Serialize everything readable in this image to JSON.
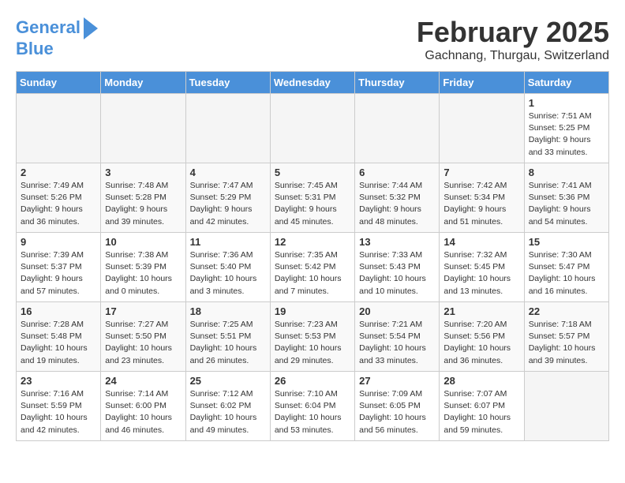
{
  "header": {
    "logo_line1": "General",
    "logo_line2": "Blue",
    "title": "February 2025",
    "subtitle": "Gachnang, Thurgau, Switzerland"
  },
  "days_of_week": [
    "Sunday",
    "Monday",
    "Tuesday",
    "Wednesday",
    "Thursday",
    "Friday",
    "Saturday"
  ],
  "weeks": [
    [
      {
        "day": "",
        "info": "",
        "empty": true
      },
      {
        "day": "",
        "info": "",
        "empty": true
      },
      {
        "day": "",
        "info": "",
        "empty": true
      },
      {
        "day": "",
        "info": "",
        "empty": true
      },
      {
        "day": "",
        "info": "",
        "empty": true
      },
      {
        "day": "",
        "info": "",
        "empty": true
      },
      {
        "day": "1",
        "info": "Sunrise: 7:51 AM\nSunset: 5:25 PM\nDaylight: 9 hours\nand 33 minutes.",
        "empty": false
      }
    ],
    [
      {
        "day": "2",
        "info": "Sunrise: 7:49 AM\nSunset: 5:26 PM\nDaylight: 9 hours\nand 36 minutes.",
        "empty": false
      },
      {
        "day": "3",
        "info": "Sunrise: 7:48 AM\nSunset: 5:28 PM\nDaylight: 9 hours\nand 39 minutes.",
        "empty": false
      },
      {
        "day": "4",
        "info": "Sunrise: 7:47 AM\nSunset: 5:29 PM\nDaylight: 9 hours\nand 42 minutes.",
        "empty": false
      },
      {
        "day": "5",
        "info": "Sunrise: 7:45 AM\nSunset: 5:31 PM\nDaylight: 9 hours\nand 45 minutes.",
        "empty": false
      },
      {
        "day": "6",
        "info": "Sunrise: 7:44 AM\nSunset: 5:32 PM\nDaylight: 9 hours\nand 48 minutes.",
        "empty": false
      },
      {
        "day": "7",
        "info": "Sunrise: 7:42 AM\nSunset: 5:34 PM\nDaylight: 9 hours\nand 51 minutes.",
        "empty": false
      },
      {
        "day": "8",
        "info": "Sunrise: 7:41 AM\nSunset: 5:36 PM\nDaylight: 9 hours\nand 54 minutes.",
        "empty": false
      }
    ],
    [
      {
        "day": "9",
        "info": "Sunrise: 7:39 AM\nSunset: 5:37 PM\nDaylight: 9 hours\nand 57 minutes.",
        "empty": false
      },
      {
        "day": "10",
        "info": "Sunrise: 7:38 AM\nSunset: 5:39 PM\nDaylight: 10 hours\nand 0 minutes.",
        "empty": false
      },
      {
        "day": "11",
        "info": "Sunrise: 7:36 AM\nSunset: 5:40 PM\nDaylight: 10 hours\nand 3 minutes.",
        "empty": false
      },
      {
        "day": "12",
        "info": "Sunrise: 7:35 AM\nSunset: 5:42 PM\nDaylight: 10 hours\nand 7 minutes.",
        "empty": false
      },
      {
        "day": "13",
        "info": "Sunrise: 7:33 AM\nSunset: 5:43 PM\nDaylight: 10 hours\nand 10 minutes.",
        "empty": false
      },
      {
        "day": "14",
        "info": "Sunrise: 7:32 AM\nSunset: 5:45 PM\nDaylight: 10 hours\nand 13 minutes.",
        "empty": false
      },
      {
        "day": "15",
        "info": "Sunrise: 7:30 AM\nSunset: 5:47 PM\nDaylight: 10 hours\nand 16 minutes.",
        "empty": false
      }
    ],
    [
      {
        "day": "16",
        "info": "Sunrise: 7:28 AM\nSunset: 5:48 PM\nDaylight: 10 hours\nand 19 minutes.",
        "empty": false
      },
      {
        "day": "17",
        "info": "Sunrise: 7:27 AM\nSunset: 5:50 PM\nDaylight: 10 hours\nand 23 minutes.",
        "empty": false
      },
      {
        "day": "18",
        "info": "Sunrise: 7:25 AM\nSunset: 5:51 PM\nDaylight: 10 hours\nand 26 minutes.",
        "empty": false
      },
      {
        "day": "19",
        "info": "Sunrise: 7:23 AM\nSunset: 5:53 PM\nDaylight: 10 hours\nand 29 minutes.",
        "empty": false
      },
      {
        "day": "20",
        "info": "Sunrise: 7:21 AM\nSunset: 5:54 PM\nDaylight: 10 hours\nand 33 minutes.",
        "empty": false
      },
      {
        "day": "21",
        "info": "Sunrise: 7:20 AM\nSunset: 5:56 PM\nDaylight: 10 hours\nand 36 minutes.",
        "empty": false
      },
      {
        "day": "22",
        "info": "Sunrise: 7:18 AM\nSunset: 5:57 PM\nDaylight: 10 hours\nand 39 minutes.",
        "empty": false
      }
    ],
    [
      {
        "day": "23",
        "info": "Sunrise: 7:16 AM\nSunset: 5:59 PM\nDaylight: 10 hours\nand 42 minutes.",
        "empty": false
      },
      {
        "day": "24",
        "info": "Sunrise: 7:14 AM\nSunset: 6:00 PM\nDaylight: 10 hours\nand 46 minutes.",
        "empty": false
      },
      {
        "day": "25",
        "info": "Sunrise: 7:12 AM\nSunset: 6:02 PM\nDaylight: 10 hours\nand 49 minutes.",
        "empty": false
      },
      {
        "day": "26",
        "info": "Sunrise: 7:10 AM\nSunset: 6:04 PM\nDaylight: 10 hours\nand 53 minutes.",
        "empty": false
      },
      {
        "day": "27",
        "info": "Sunrise: 7:09 AM\nSunset: 6:05 PM\nDaylight: 10 hours\nand 56 minutes.",
        "empty": false
      },
      {
        "day": "28",
        "info": "Sunrise: 7:07 AM\nSunset: 6:07 PM\nDaylight: 10 hours\nand 59 minutes.",
        "empty": false
      },
      {
        "day": "",
        "info": "",
        "empty": true
      }
    ]
  ]
}
